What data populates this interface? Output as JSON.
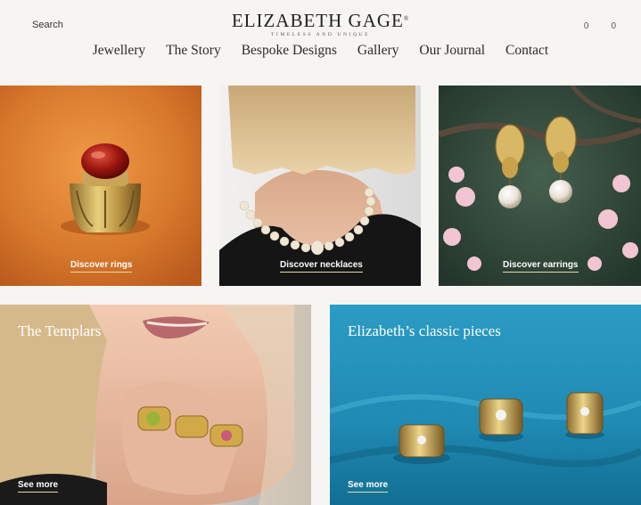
{
  "header": {
    "search_label": "Search",
    "logo_title": "ELIZABETH GAGE",
    "logo_mark": "®",
    "logo_tagline": "TIMELESS AND UNIQUE",
    "counter_left": "0",
    "counter_right": "0"
  },
  "nav": {
    "items": [
      "Jewellery",
      "The Story",
      "Bespoke Designs",
      "Gallery",
      "Our Journal",
      "Contact"
    ]
  },
  "tiles": {
    "rings": {
      "cta": "Discover rings"
    },
    "necklaces": {
      "cta": "Discover necklaces"
    },
    "earrings": {
      "cta": "Discover earrings"
    },
    "templars": {
      "title": "The Templars",
      "cta": "See more"
    },
    "classic": {
      "title": "Elizabeth’s classic pieces",
      "cta": "See more"
    }
  },
  "colors": {
    "background": "#f7f5f2",
    "cta_underline": "#e9d7a6",
    "rings_bg": "#d7782c",
    "earrings_bg": "#334a3c",
    "classic_bg": "#1f8ab3"
  }
}
